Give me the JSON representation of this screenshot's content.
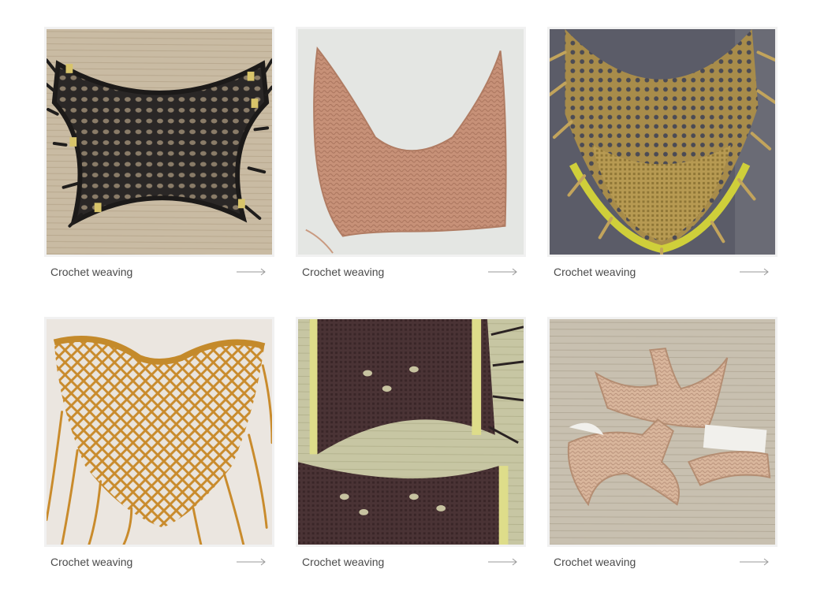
{
  "products": [
    {
      "label": "Crochet weaving",
      "arrow_icon": "long-arrow-right-icon",
      "image": "black-crochet-yoke"
    },
    {
      "label": "Crochet weaving",
      "arrow_icon": "long-arrow-right-icon",
      "image": "peach-crochet-yoke"
    },
    {
      "label": "Crochet weaving",
      "arrow_icon": "long-arrow-right-icon",
      "image": "gold-mesh-collar"
    },
    {
      "label": "Crochet weaving",
      "arrow_icon": "long-arrow-right-icon",
      "image": "mustard-macrame-collar"
    },
    {
      "label": "Crochet weaving",
      "arrow_icon": "long-arrow-right-icon",
      "image": "brown-woven-straps"
    },
    {
      "label": "Crochet weaving",
      "arrow_icon": "long-arrow-right-icon",
      "image": "tan-crochet-pieces"
    }
  ],
  "colors": {
    "caption_text": "#4a4a4a",
    "card_border": "#f1f1f1",
    "arrow": "#999999"
  }
}
